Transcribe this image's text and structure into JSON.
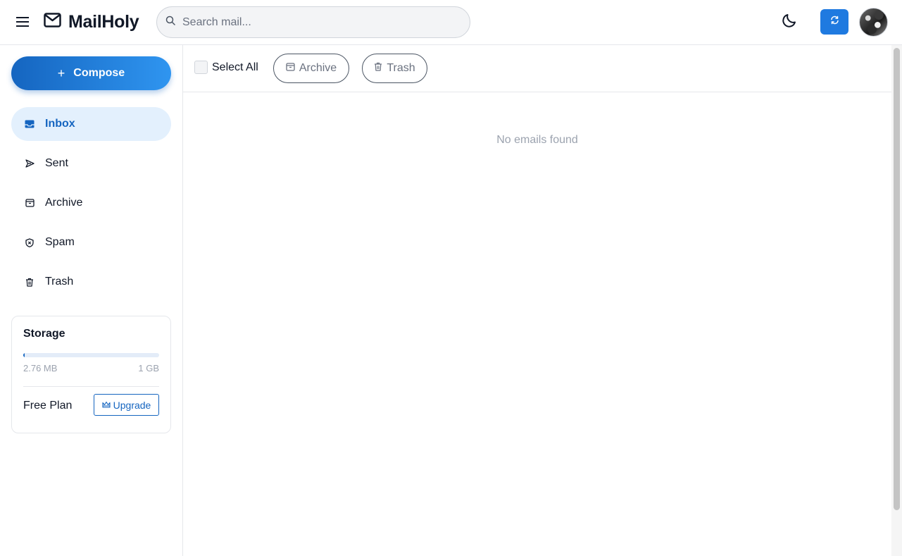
{
  "app": {
    "name": "MailHoly"
  },
  "header": {
    "menu_icon": "hamburger-menu-icon",
    "logo_icon": "envelope-icon",
    "search": {
      "placeholder": "Search mail...",
      "value": ""
    },
    "theme_icon": "moon-icon",
    "refresh_icon": "refresh-icon",
    "accent_color": "#1f7ae0"
  },
  "sidebar": {
    "compose_label": "Compose",
    "items": [
      {
        "label": "Inbox",
        "icon": "inbox-icon",
        "active": true
      },
      {
        "label": "Sent",
        "icon": "send-icon",
        "active": false
      },
      {
        "label": "Archive",
        "icon": "archive-icon",
        "active": false
      },
      {
        "label": "Spam",
        "icon": "shield-icon",
        "active": false
      },
      {
        "label": "Trash",
        "icon": "trash-icon",
        "active": false
      }
    ],
    "storage": {
      "title": "Storage",
      "used": "2.76 MB",
      "total": "1 GB",
      "used_fraction": 0.0027,
      "plan": "Free Plan",
      "upgrade_label": "Upgrade"
    }
  },
  "main": {
    "toolbar": {
      "select_all_label": "Select All",
      "archive_label": "Archive",
      "trash_label": "Trash"
    },
    "empty_message": "No emails found"
  },
  "colors": {
    "primary": "#1565c0",
    "active_nav_bg": "#e3f0fd",
    "muted_text": "#9ca3af"
  }
}
